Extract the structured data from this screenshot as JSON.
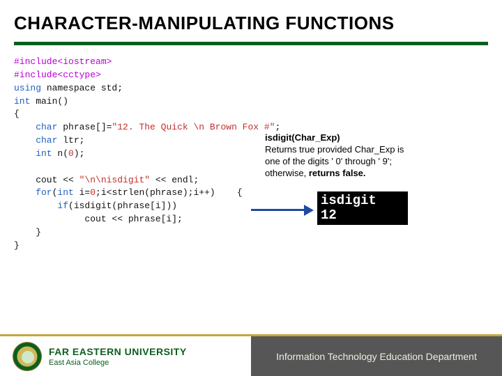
{
  "title": "CHARACTER-MANIPULATING FUNCTIONS",
  "code": {
    "l1a": "#include",
    "l1b": "<iostream>",
    "l2a": "#include",
    "l2b": "<cctype>",
    "l3a": "using",
    "l3b": " namespace std;",
    "l4a": "int",
    "l4b": " main()",
    "l5": "{",
    "l6a": "    char",
    "l6b": " phrase[]=",
    "l6c": "\"12. The Quick \\n Brown Fox #\"",
    "l6d": ";",
    "l7a": "    char",
    "l7b": " ltr;",
    "l8a": "    int",
    "l8b": " n(",
    "l8c": "0",
    "l8d": ");",
    "blank1": " ",
    "l9a": "    cout << ",
    "l9b": "\"\\n\\nisdigit\"",
    "l9c": " << endl;",
    "l10a": "    for",
    "l10b": "(",
    "l10c": "int",
    "l10d": " i=",
    "l10e": "0",
    "l10f": ";i<strlen(phrase);i++)    {",
    "l11a": "        if",
    "l11b": "(isdigit(phrase[i]))",
    "l12": "             cout << phrase[i];",
    "l13": "    }",
    "l14": "}"
  },
  "desc": {
    "sig": "isdigit(Char_Exp)",
    "l1": "Returns true provided Char_Exp is",
    "l2": "one of the digits ' 0' through ' 9';",
    "l3a": "otherwise, ",
    "l3b": "returns false."
  },
  "output": {
    "l1": "isdigit",
    "l2": "12"
  },
  "footer": {
    "uni": "FAR EASTERN UNIVERSITY",
    "sub": "East Asia College",
    "dept": "Information Technology Education Department"
  }
}
